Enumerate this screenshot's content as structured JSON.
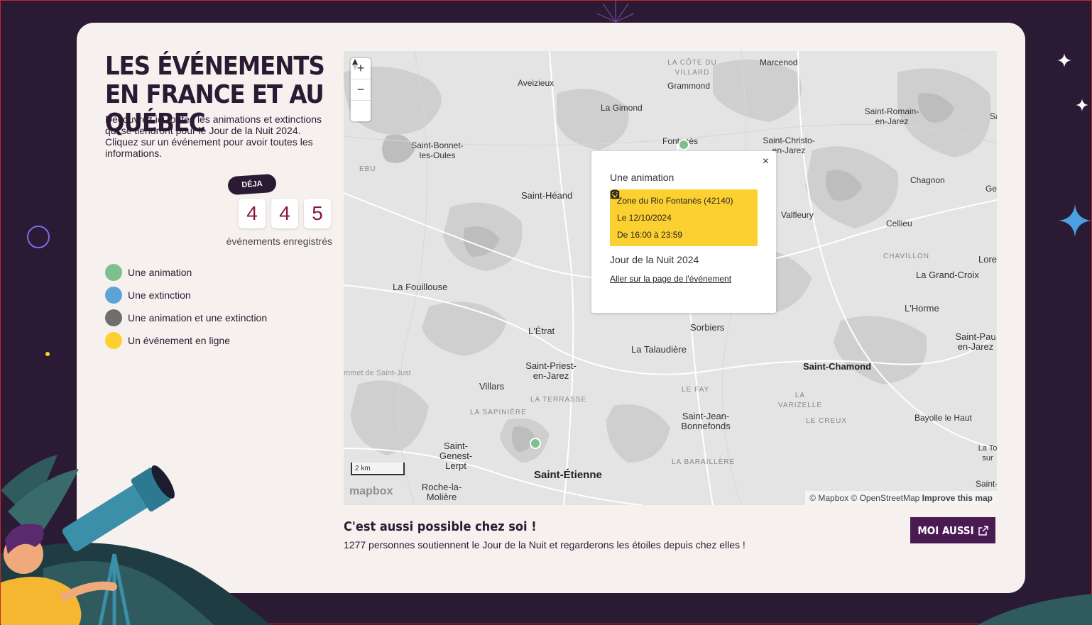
{
  "section": {
    "title": "LES ÉVÉNEMENTS EN FRANCE ET AU QUÉBEC",
    "intro": "Découvrez ici toutes les animations et extinctions qui se tiendront pour le Jour de la Nuit 2024. Cliquez sur un événement pour avoir toutes les informations."
  },
  "counter": {
    "badge": "DÉJA",
    "digits": [
      "4",
      "4",
      "5"
    ],
    "label": "événements enregistrés"
  },
  "legend": [
    {
      "label": "Une animation",
      "color": "#7fbf8e"
    },
    {
      "label": "Une extinction",
      "color": "#5ea3d8"
    },
    {
      "label": "Une animation et une extinction",
      "color": "#6e6e6e"
    },
    {
      "label": "Un événement en ligne",
      "color": "#fdd032"
    }
  ],
  "map": {
    "zoom_in": "+",
    "zoom_out": "−",
    "scale_label": "2 km",
    "logo": "mapbox",
    "attribution": "© Mapbox © OpenStreetMap",
    "improve_link": "Improve this map",
    "places": {
      "la_cote_du_villard": "LA CÔTE DU VILLARD",
      "marcenod": "Marcenod",
      "aveizieux": "Aveizieux",
      "grammond": "Grammond",
      "la_gimond": "La Gimond",
      "saint_romain_en_jarez": "Saint-Romain-en-Jarez",
      "sa": "Sa",
      "fontanes": "Fontanès",
      "saint_bonnet_les_oules": "Saint-Bonnet-les-Oules",
      "saint_christo_en_jarez": "Saint-Christo-en-Jarez",
      "ebu": "EBU",
      "chagnon": "Chagnon",
      "ge": "Ge",
      "saint_heand": "Saint-Héand",
      "valfleury": "Valfleury",
      "cellieu": "Cellieu",
      "chavillon": "CHAVILLON",
      "lore": "Lore",
      "la_grand_croix": "La Grand-Croix",
      "la_fouillouse": "La Fouillouse",
      "lhorme": "L'Horme",
      "letrat": "L'Étrat",
      "sorbiers": "Sorbiers",
      "la_talaudiere": "La Talaudière",
      "saint_paul_en_jarez": "Saint-Pau en-Jarez",
      "saint_chamond": "Saint-Chamond",
      "saint_just": "mmet de Saint-Just",
      "saint_priest_en_jarez": "Saint-Priest-en-Jarez",
      "villars": "Villars",
      "le_fay": "LE FAY",
      "la_terrasse": "LA TERRASSE",
      "la_varizelle": "LA VARIZELLE",
      "la_sapiniere": "LA SAPINIÈRE",
      "le_creux": "LE CREUX",
      "bayolle_le_haut": "Bayolle le Haut",
      "saint_jean_bonnefonds": "Saint-Jean-Bonnefonds",
      "saint_genest_lerpt": "Saint-Genest-Lerpt",
      "la_tour_sur": "La To sur",
      "la_baraillere": "LA BARAILLÈRE",
      "saint_etienne": "Saint-Étienne",
      "roche_la_moliere": "Roche-la-Molière",
      "saint_bottom": "Saint-"
    },
    "popup": {
      "type": "Une animation",
      "location": "Zone du Rio Fontanès (42140)",
      "date": "Le 12/10/2024",
      "time": "De 16:00 à 23:59",
      "name": "Jour de la Nuit 2024",
      "link": "Aller sur la page de l'événement",
      "close": "×"
    }
  },
  "cta": {
    "title": "C'est aussi possible chez soi !",
    "text": "1277 personnes soutiennent le Jour de la Nuit et regarderons les étoiles depuis chez elles !",
    "button": "MOI AUSSI"
  }
}
